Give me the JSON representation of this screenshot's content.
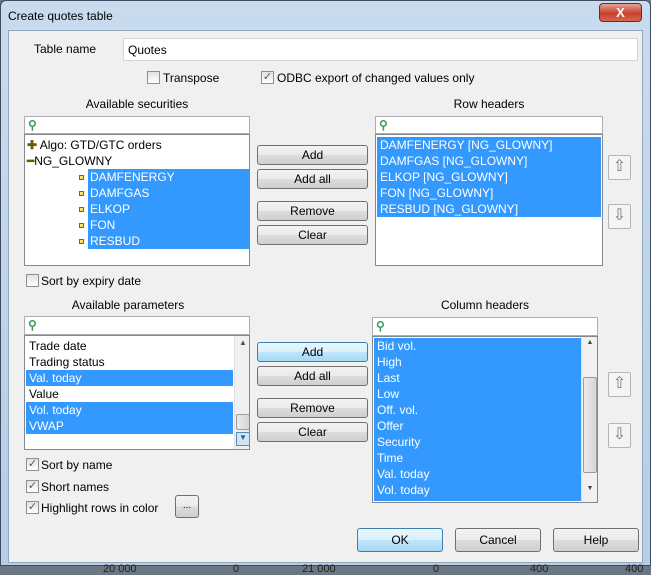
{
  "window": {
    "title": "Create quotes table",
    "close_label": "X"
  },
  "table_name": {
    "label": "Table name",
    "value": "Quotes"
  },
  "options": {
    "transpose": {
      "label": "Transpose",
      "checked": false
    },
    "odbc": {
      "label": "ODBC export of changed values only",
      "checked": true
    }
  },
  "securities": {
    "title": "Available securities",
    "search_placeholder": "",
    "tree": [
      {
        "label": "Algo: GTD/GTC orders",
        "expanded": false
      },
      {
        "label": "NG_GLOWNY",
        "expanded": true,
        "children": [
          "DAMFENERGY",
          "DAMFGAS",
          "ELKOP",
          "FON",
          "RESBUD"
        ]
      }
    ],
    "sort_by_expiry": {
      "label": "Sort by expiry date",
      "checked": false
    }
  },
  "row_headers": {
    "title": "Row headers",
    "items": [
      "DAMFENERGY [NG_GLOWNY]",
      "DAMFGAS [NG_GLOWNY]",
      "ELKOP [NG_GLOWNY]",
      "FON [NG_GLOWNY]",
      "RESBUD [NG_GLOWNY]"
    ]
  },
  "buttons": {
    "add": "Add",
    "add_all": "Add all",
    "remove": "Remove",
    "clear": "Clear",
    "ok": "OK",
    "cancel": "Cancel",
    "help": "Help",
    "color": "...",
    "up": "⇧",
    "down": "⇩"
  },
  "parameters": {
    "title": "Available parameters",
    "items": [
      {
        "label": "Trade date",
        "selected": false
      },
      {
        "label": "Trading status",
        "selected": false
      },
      {
        "label": "Val. today",
        "selected": true
      },
      {
        "label": "Value",
        "selected": false
      },
      {
        "label": "Vol. today",
        "selected": true
      },
      {
        "label": "VWAP",
        "selected": true
      }
    ]
  },
  "column_headers": {
    "title": "Column headers",
    "items": [
      "Bid vol.",
      "High",
      "Last",
      "Low",
      "Off. vol.",
      "Offer",
      "Security",
      "Time",
      "Val. today",
      "Vol. today"
    ]
  },
  "checks": {
    "sort_by_name": {
      "label": "Sort by name",
      "checked": true
    },
    "short_names": {
      "label": "Short names",
      "checked": true
    },
    "highlight": {
      "label": "Highlight rows in color",
      "checked": true
    }
  },
  "background_text": [
    "20 000",
    "0",
    "21 000",
    "0",
    "400",
    "400"
  ],
  "colors": {
    "selection": "#3399ff",
    "search_icon": "#3f9a5a"
  }
}
